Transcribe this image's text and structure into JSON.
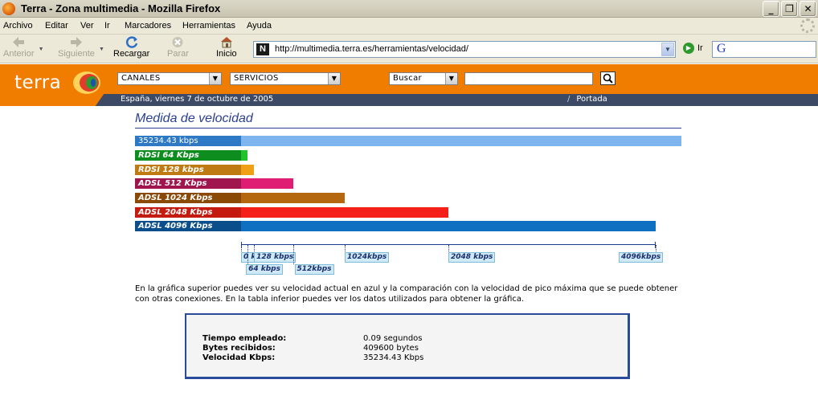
{
  "window": {
    "title": "Terra - Zona multimedia - Mozilla Firefox",
    "controls": [
      "_",
      "❐",
      "✕"
    ]
  },
  "menu": [
    "Archivo",
    "Editar",
    "Ver",
    "Ir",
    "Marcadores",
    "Herramientas",
    "Ayuda"
  ],
  "toolbar": {
    "back": "Anterior",
    "forward": "Siguiente",
    "reload": "Recargar",
    "stop": "Parar",
    "home": "Inicio",
    "url": "http://multimedia.terra.es/herramientas/velocidad/",
    "go": "Ir",
    "search_engine_letter": "G"
  },
  "site": {
    "logo": "terra",
    "canales": "CANALES",
    "servicios": "SERVICIOS",
    "buscar": "Buscar",
    "search_value": "",
    "date": "España, viernes 7 de octubre de 2005",
    "portada": "Portada"
  },
  "content": {
    "title": "Medida de velocidad",
    "bars": [
      {
        "label": "35234.43 kbps",
        "kbps": 35234.43,
        "dark": "#2e79c6",
        "light": "#7fb5ef",
        "italic": false
      },
      {
        "label": "RDSI  64 Kbps",
        "kbps": 64,
        "dark": "#0e8d1f",
        "light": "#22c12e",
        "italic": true
      },
      {
        "label": "RDSI 128 kbps",
        "kbps": 128,
        "dark": "#c07a12",
        "light": "#f0a015",
        "italic": true
      },
      {
        "label": "ADSL 512 Kbps",
        "kbps": 512,
        "dark": "#a0154d",
        "light": "#df1d72",
        "italic": true
      },
      {
        "label": "ADSL 1024 Kbps",
        "kbps": 1024,
        "dark": "#8a4a06",
        "light": "#b5670f",
        "italic": true
      },
      {
        "label": "ADSL 2048 Kbps",
        "kbps": 2048,
        "dark": "#c41a10",
        "light": "#f5201a",
        "italic": true
      },
      {
        "label": "ADSL 4096 Kbps",
        "kbps": 4096,
        "dark": "#0a4f8c",
        "light": "#0f6fc0",
        "italic": true
      }
    ],
    "scale": {
      "max_kbps": 4096,
      "ticks": [
        {
          "label": "0 kbps",
          "kbps": 0,
          "row": 0
        },
        {
          "label": "64 kbps",
          "kbps": 64,
          "row": 1
        },
        {
          "label": "128 kbps",
          "kbps": 128,
          "row": 0
        },
        {
          "label": "512kbps",
          "kbps": 512,
          "row": 1
        },
        {
          "label": "1024kbps",
          "kbps": 1024,
          "row": 0
        },
        {
          "label": "2048 kbps",
          "kbps": 2048,
          "row": 0
        },
        {
          "label": "4096kbps",
          "kbps": 4096,
          "row": 0
        }
      ]
    },
    "description": "En la gráfica superior puedes ver su velocidad actual en azul y la comparación con la velocidad de pico máxima que se puede obtener con otras conexiones. En la tabla inferior puedes ver los datos utilizados para obtener la gráfica.",
    "stats": [
      {
        "key": "Tiempo empleado:",
        "value": "0.09 segundos"
      },
      {
        "key": "Bytes recibidos:",
        "value": "409600 bytes"
      },
      {
        "key": "Velocidad Kbps:",
        "value": "35234.43 Kbps"
      }
    ]
  }
}
